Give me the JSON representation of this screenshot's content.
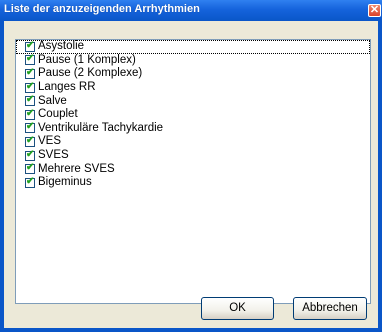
{
  "window": {
    "title": "Liste der anzuzeigenden Arrhythmien",
    "close_glyph": "✕"
  },
  "list": {
    "items": [
      {
        "label": "Asystolie",
        "checked": true
      },
      {
        "label": "Pause (1 Komplex)",
        "checked": true
      },
      {
        "label": "Pause (2 Komplexe)",
        "checked": true
      },
      {
        "label": "Langes RR",
        "checked": true
      },
      {
        "label": "Salve",
        "checked": true
      },
      {
        "label": "Couplet",
        "checked": true
      },
      {
        "label": "Ventrikuläre Tachykardie",
        "checked": true
      },
      {
        "label": "VES",
        "checked": true
      },
      {
        "label": "SVES",
        "checked": true
      },
      {
        "label": "Mehrere SVES",
        "checked": true
      },
      {
        "label": "Bigeminus",
        "checked": true
      }
    ]
  },
  "buttons": {
    "ok_label": "OK",
    "cancel_label": "Abbrechen"
  },
  "colors": {
    "titlebar": "#0a56c8",
    "dialog_bg": "#ece9d8",
    "check_color": "#21a121"
  }
}
